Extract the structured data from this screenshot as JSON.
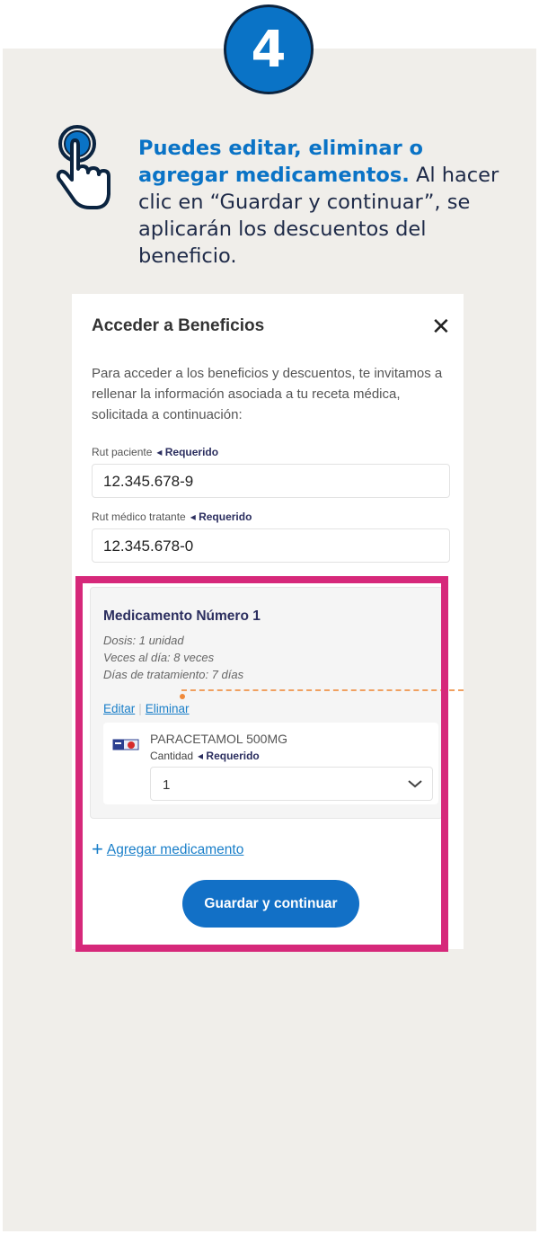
{
  "step": {
    "number": "4"
  },
  "intro": {
    "highlight": "Puedes editar, eliminar o agregar medicamentos.",
    "text": " Al hacer clic en  “Guardar y continuar”, se aplicarán los descuentos del beneficio."
  },
  "icons": {
    "hand": "pointing-hand-icon",
    "close": "close-icon",
    "dropdown": "chevron-down-icon",
    "add": "plus-icon"
  },
  "modal": {
    "title": "Acceder a Beneficios",
    "close_symbol": "✕",
    "description": "Para acceder a los beneficios y descuentos, te invitamos a rellenar la información asociada a tu receta médica, solicitada a continuación:",
    "fields": [
      {
        "label": "Rut paciente",
        "required": "◂ Requerido",
        "value": "12.345.678-9"
      },
      {
        "label": "Rut médico tratante",
        "required": "◂ Requerido",
        "value": "12.345.678-0"
      }
    ],
    "medication": {
      "title": "Medicamento Número 1",
      "details": [
        "Dosis: 1 unidad",
        "Veces al día: 8 veces",
        "Días de tratamiento: 7 días"
      ],
      "edit_label": "Editar",
      "delete_label": "Eliminar",
      "product": {
        "name": "PARACETAMOL 500MG",
        "quantity_label": "Cantidad",
        "required": "◂ Requerido",
        "quantity_value": "1"
      }
    },
    "add_medication": {
      "symbol": "+",
      "label": "Agregar medicamento"
    },
    "save_button": "Guardar y continuar"
  },
  "colors": {
    "accent": "#0a73c6",
    "highlight_frame": "#d6287a",
    "panel_bg": "#f0eeea",
    "navy": "#2b2e5f"
  }
}
